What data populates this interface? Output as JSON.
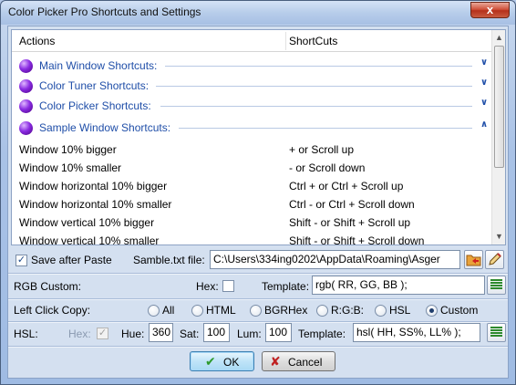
{
  "window": {
    "title": "Color Picker Pro Shortcuts and Settings",
    "close_label": "x"
  },
  "list": {
    "columns": [
      "Actions",
      "ShortCuts"
    ],
    "groups": [
      "Main Window Shortcuts:",
      "Color Tuner Shortcuts:",
      "Color Picker Shortcuts:",
      "Sample Window Shortcuts:"
    ],
    "group_states": [
      "collapsed",
      "collapsed",
      "collapsed",
      "expanded"
    ],
    "rows": [
      {
        "action": "Window 10% bigger",
        "shortcut": "+ or Scroll up"
      },
      {
        "action": "Window 10% smaller",
        "shortcut": "- or Scroll down"
      },
      {
        "action": "Window horizontal 10% bigger",
        "shortcut": "Ctrl + or Ctrl + Scroll up"
      },
      {
        "action": "Window horizontal 10% smaller",
        "shortcut": "Ctrl - or Ctrl + Scroll down"
      },
      {
        "action": "Window vertical 10% bigger",
        "shortcut": "Shift - or Shift + Scroll up"
      },
      {
        "action": "Window vertical 10% smaller",
        "shortcut": "Shift - or Shift + Scroll down"
      }
    ]
  },
  "settings": {
    "save_after_paste_label": "Save after Paste",
    "save_after_paste_checked": true,
    "sample_file_label": "Samble.txt file:",
    "sample_file_value": "C:\\Users\\334ing0202\\AppData\\Roaming\\Asger",
    "rgb_label": "RGB  Custom:",
    "hex_label": "Hex:",
    "hex_checked": false,
    "template_label": "Template:",
    "rgb_template_value": "rgb( RR, GG, BB );",
    "left_click_label": "Left Click Copy:",
    "copy_options": [
      "All",
      "HTML",
      "BGRHex",
      "R:G:B:",
      "HSL",
      "Custom"
    ],
    "copy_selected": "Custom",
    "hsl_label": "HSL:",
    "hsl_hex_label": "Hex:",
    "hsl_hex_checked": true,
    "hue_label": "Hue:",
    "hue_value": "360",
    "sat_label": "Sat:",
    "sat_value": "100",
    "lum_label": "Lum:",
    "lum_value": "100",
    "hsl_template_label": "Template:",
    "hsl_template_value": "hsl( HH, SS%, LL% );"
  },
  "buttons": {
    "ok_label": "OK",
    "cancel_label": "Cancel"
  },
  "colors": {
    "group_text": "#1f4ea8",
    "ok_icon": "#2d9a2d",
    "cancel_icon": "#c02020"
  }
}
